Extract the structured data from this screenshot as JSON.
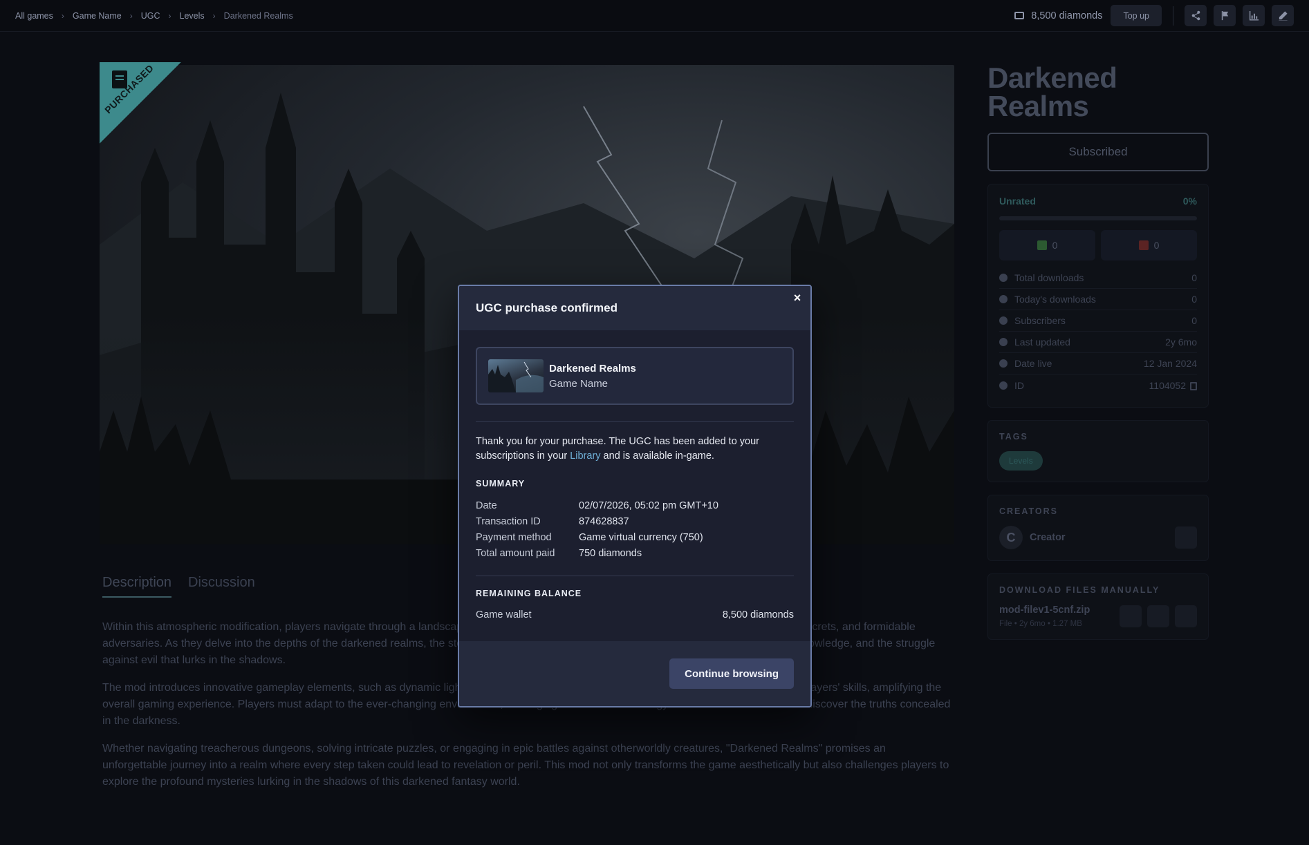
{
  "breadcrumb": [
    "All games",
    "Game Name",
    "UGC",
    "Levels",
    "Darkened Realms"
  ],
  "header": {
    "wallet_text": "8,500 diamonds",
    "topup_label": "Top up",
    "icons": [
      "share-icon",
      "flag-icon",
      "stats-icon",
      "edit-icon"
    ]
  },
  "hero": {
    "ribbon_text": "PURCHASED"
  },
  "tabs": [
    "Description",
    "Discussion"
  ],
  "description": [
    "Within this atmospheric modification, players navigate through a landscape shrouded in shadows, encountering mysterious characters, hidden secrets, and formidable adversaries. As they delve into the depths of the darkened realms, the storyline unfolds, revealing a gripping tale of ancient powers, forbidden knowledge, and the struggle against evil that lurks in the shadows.",
    "The mod introduces innovative gameplay elements, such as dynamic lighting effects, intricate level designs, and challenging puzzles that push players' skills, amplifying the overall gaming experience. Players must adapt to the ever-changing environment, leveraging their wits and strategy to overcome obstacles and discover the truths concealed in the darkness.",
    "Whether navigating treacherous dungeons, solving intricate puzzles, or engaging in epic battles against otherworldly creatures, \"Darkened Realms\" promises an unforgettable journey into a realm where every step taken could lead to revelation or peril. This mod not only transforms the game aesthetically but also challenges players to explore the profound mysteries lurking in the shadows of this darkened fantasy world."
  ],
  "sidebar": {
    "title": "Darkened Realms",
    "subscribe_label": "Subscribed",
    "rating_label": "Unrated",
    "rating_percent": "0%",
    "upvotes": "0",
    "downvotes": "0",
    "stats": [
      {
        "label": "Total downloads",
        "value": "0",
        "icon": "download-icon"
      },
      {
        "label": "Today's downloads",
        "value": "0",
        "icon": "clock-icon"
      },
      {
        "label": "Subscribers",
        "value": "0",
        "icon": "users-icon"
      },
      {
        "label": "Last updated",
        "value": "2y 6mo",
        "icon": "refresh-icon"
      },
      {
        "label": "Date live",
        "value": "12 Jan 2024",
        "icon": "rocket-icon"
      },
      {
        "label": "ID",
        "value": "1104052",
        "icon": "hash-icon"
      }
    ],
    "tags_heading": "TAGS",
    "tags": [
      "Levels"
    ],
    "creators_heading": "CREATORS",
    "creator_initial": "C",
    "creator_name": "Creator",
    "files_heading": "DOWNLOAD FILES MANUALLY",
    "file_name": "mod-filev1-5cnf.zip",
    "file_meta": "File • 2y 6mo • 1.27 MB"
  },
  "modal": {
    "title": "UGC purchase confirmed",
    "close": "×",
    "item_name": "Darkened Realms",
    "item_game": "Game Name",
    "thanks_pre": "Thank you for your purchase. The UGC has been added to your subscriptions in your ",
    "thanks_link": "Library",
    "thanks_post": " and is available in-game.",
    "summary_heading": "SUMMARY",
    "summary": [
      {
        "k": "Date",
        "v": "02/07/2026, 05:02 pm GMT+10"
      },
      {
        "k": "Transaction ID",
        "v": "874628837"
      },
      {
        "k": "Payment method",
        "v": "Game virtual currency (750)"
      },
      {
        "k": "Total amount paid",
        "v": "750 diamonds"
      }
    ],
    "balance_heading": "REMAINING BALANCE",
    "wallet_label": "Game wallet",
    "wallet_value": "8,500 diamonds",
    "continue_label": "Continue browsing"
  }
}
